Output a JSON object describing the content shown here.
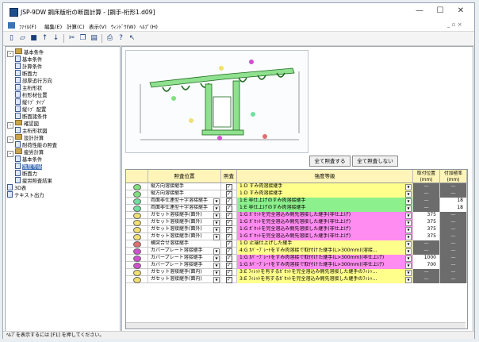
{
  "window": {
    "title": "JSP-9DW 鋼床版桁の断面計算 - [鋼手-桁形1.d09]",
    "minimize": "—",
    "maximize": "☐",
    "close": "✕"
  },
  "menubar": {
    "items": [
      "ﾌｧｲﾙ(F)",
      "編集(E)",
      "計算(C)",
      "表示(V)",
      "ｳｨﾝﾄﾞｳ(W)",
      "ﾍﾙﾌﾟ(H)"
    ],
    "mdi_controls": "_ ▫ ×"
  },
  "toolbar": {
    "icons": [
      "new-file-icon",
      "open-folder-icon",
      "save-icon",
      "arrow-up-icon",
      "arrow-down-icon",
      "cut-icon",
      "copy-icon",
      "paste-icon",
      "print-icon",
      "help-icon",
      "context-help-icon"
    ]
  },
  "tree": {
    "nodes": [
      {
        "label": "基本条件",
        "level": 0,
        "type": "folder",
        "expander": "-"
      },
      {
        "label": "基本条件",
        "level": 1,
        "type": "doc"
      },
      {
        "label": "計算条件",
        "level": 1,
        "type": "doc"
      },
      {
        "label": "断面力",
        "level": 1,
        "type": "doc"
      },
      {
        "label": "部厚追行方向",
        "level": 1,
        "type": "doc"
      },
      {
        "label": "主桁形状",
        "level": 1,
        "type": "doc"
      },
      {
        "label": "桁形材位置",
        "level": 1,
        "type": "doc"
      },
      {
        "label": "縦ﾘﾌﾞ ﾀｲﾌﾟ",
        "level": 1,
        "type": "doc"
      },
      {
        "label": "縦ﾘﾌﾞ 配置",
        "level": 1,
        "type": "doc"
      },
      {
        "label": "断面諸条件",
        "level": 1,
        "type": "doc"
      },
      {
        "label": "確認図",
        "level": 0,
        "type": "folder",
        "expander": "-"
      },
      {
        "label": "主桁形状図",
        "level": 1,
        "type": "doc"
      },
      {
        "label": "設計計算",
        "level": 0,
        "type": "folder",
        "expander": "-"
      },
      {
        "label": "耐荷性能の照査",
        "level": 1,
        "type": "doc"
      },
      {
        "label": "疲労計算",
        "level": 0,
        "type": "folder",
        "expander": "-"
      },
      {
        "label": "基本条件",
        "level": 1,
        "type": "doc"
      },
      {
        "label": "強度等級",
        "level": 1,
        "type": "doc",
        "selected": true
      },
      {
        "label": "断面力",
        "level": 1,
        "type": "doc"
      },
      {
        "label": "疲労照査結果",
        "level": 1,
        "type": "doc"
      },
      {
        "label": "3D表",
        "level": 0,
        "type": "doc"
      },
      {
        "label": "テキスト出力",
        "level": 0,
        "type": "doc"
      }
    ]
  },
  "buttons": {
    "check_all": "全て照査する",
    "check_none": "全て照査しない"
  },
  "table": {
    "headers": {
      "position": "照査位置",
      "check": "照査",
      "grade": "強度等級",
      "attach_pos": "取付位置(mm)",
      "attach_len": "付加極率(mm)"
    },
    "rows": [
      {
        "no": "①",
        "color": "#7fe07f",
        "position": "縦方向溶接継手",
        "pos_dd": false,
        "checked": true,
        "grade": "1:D すみ肉溶接継手",
        "grade_color": "#ffff8c",
        "attach": "",
        "extra": ""
      },
      {
        "no": "②",
        "color": "#7fe07f",
        "position": "縦方向溶接継手",
        "pos_dd": false,
        "checked": true,
        "grade": "1:D すみ肉溶接継手",
        "grade_color": "#ffff8c",
        "attach": "",
        "extra": ""
      },
      {
        "no": "③",
        "color": "#6fe0a0",
        "position": "両面非仕連型十字溶接継手",
        "pos_dd": true,
        "checked": true,
        "grade": "1:E 非仕上げのすみ肉溶接継手",
        "grade_color": "#8cf08c",
        "attach": "",
        "extra": "18"
      },
      {
        "no": "④",
        "color": "#6fe0a0",
        "position": "両面非仕連型十字溶接継手",
        "pos_dd": true,
        "checked": true,
        "grade": "1:E 非仕上げのすみ肉溶接継手",
        "grade_color": "#8cf08c",
        "attach": "",
        "extra": "18"
      },
      {
        "no": "⑤",
        "color": "#f0e070",
        "position": "ガセット溶接継手(面外)",
        "pos_dd": true,
        "checked": true,
        "grade": "1:G ｶﾞｾｯﾄを完全溶込み開先溶接した継手(非仕上げ)",
        "grade_color": "#ff8cf0",
        "attach": "375",
        "extra": ""
      },
      {
        "no": "⑥",
        "color": "#f0e070",
        "position": "ガセット溶接継手(面外)",
        "pos_dd": true,
        "checked": true,
        "grade": "1:G ｶﾞｾｯﾄを完全溶込み開先溶接した継手(非仕上げ)",
        "grade_color": "#ff8cf0",
        "attach": "375",
        "extra": ""
      },
      {
        "no": "⑦",
        "color": "#f0e070",
        "position": "ガセット溶接継手(面外)",
        "pos_dd": true,
        "checked": true,
        "grade": "1:G ｶﾞｾｯﾄを完全溶込み開先溶接した継手(非仕上げ)",
        "grade_color": "#ff8cf0",
        "attach": "375",
        "extra": ""
      },
      {
        "no": "⑧",
        "color": "#f0e070",
        "position": "ガセット溶接継手(面外)",
        "pos_dd": true,
        "checked": true,
        "grade": "1:G ｶﾞｾｯﾄを完全溶込み開先溶接した継手(非仕上げ)",
        "grade_color": "#ff8cf0",
        "attach": "375",
        "extra": ""
      },
      {
        "no": "⑨",
        "color": "#e07070",
        "position": "横突合せ溶接継手",
        "pos_dd": false,
        "checked": true,
        "grade": "1:D 止端仕上げした継手",
        "grade_color": "#ffff8c",
        "attach": "",
        "extra": ""
      },
      {
        "no": "⑩",
        "color": "#d050d0",
        "position": "カバープレート溶接継手",
        "pos_dd": true,
        "checked": true,
        "grade": "4:G ｶﾊﾞｰﾌﾟﾚｰﾄをすみ肉溶接で取付けた継手(L>300mm)(溶接...",
        "grade_color": "#ffff8c",
        "attach": "",
        "extra": ""
      },
      {
        "no": "⑪",
        "color": "#d050d0",
        "position": "カバープレート溶接継手",
        "pos_dd": true,
        "checked": true,
        "grade": "1:G ｶﾊﾞｰﾌﾟﾚｰﾄをすみ肉溶接で取付けた継手(L>300mm)(非仕上げ)",
        "grade_color": "#ff8cf0",
        "attach": "1000",
        "extra": ""
      },
      {
        "no": "⑫",
        "color": "#d050d0",
        "position": "カバープレート溶接継手",
        "pos_dd": true,
        "checked": true,
        "grade": "1:G ｶﾊﾞｰﾌﾟﾚｰﾄをすみ肉溶接で取付けた継手(L>300mm)(非仕上げ)",
        "grade_color": "#ff8cf0",
        "attach": "700",
        "extra": ""
      },
      {
        "no": "⑬",
        "color": "#f0e070",
        "position": "ガセット溶接継手(面内)",
        "pos_dd": true,
        "checked": true,
        "grade": "3:E ﾌｨﾚｯﾄを有するｶﾞｾｯﾄを完全溶込み開先溶接した継手のﾌｨﾚｯ...",
        "grade_color": "#ffff8c",
        "attach": "",
        "extra": ""
      },
      {
        "no": "⑭",
        "color": "#f0e070",
        "position": "ガセット溶接継手(面内)",
        "pos_dd": true,
        "checked": true,
        "grade": "3:E ﾌｨﾚｯﾄを有するｶﾞｾｯﾄを完全溶込み開先溶接した継手のﾌｨﾚｯ...",
        "grade_color": "#ffff8c",
        "attach": "",
        "extra": ""
      }
    ],
    "dash_mark": "—"
  },
  "status": {
    "text": "ﾍﾙﾌﾟを表示するには [F1] を押してください。"
  }
}
